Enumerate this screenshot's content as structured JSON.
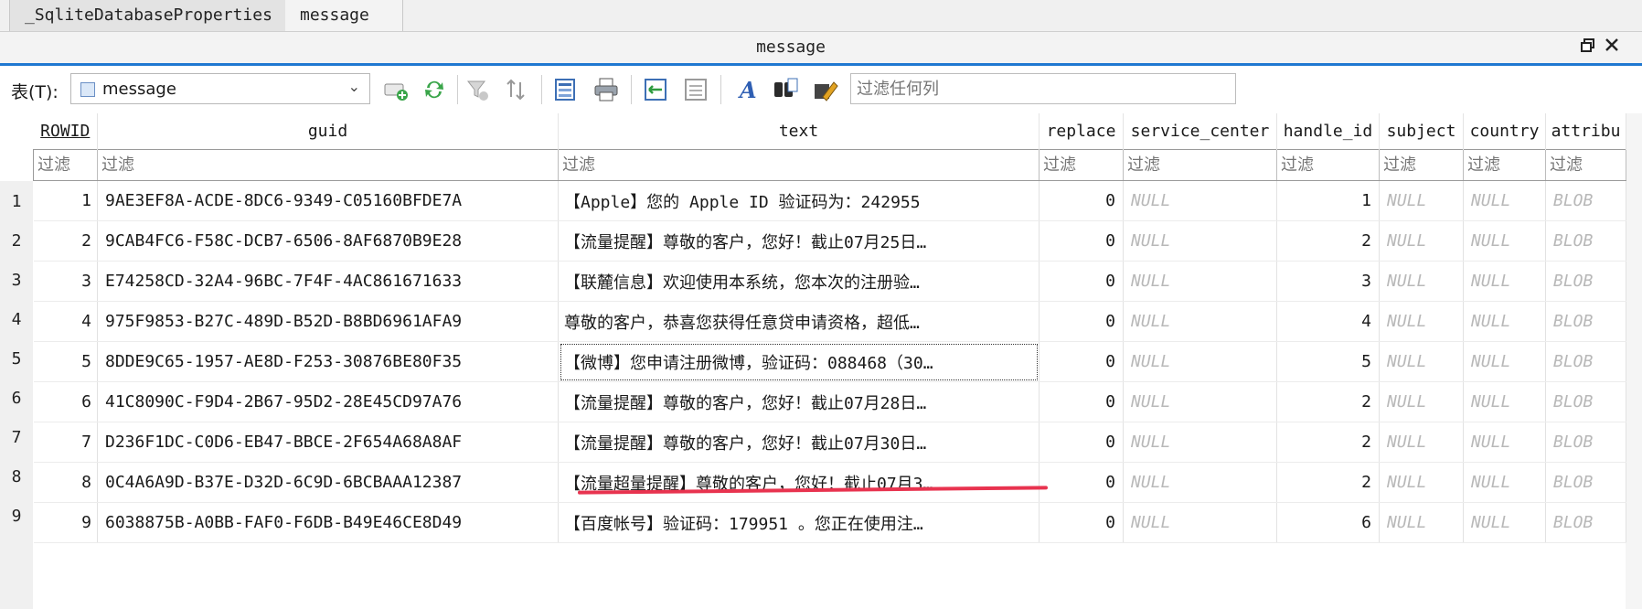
{
  "tabs": [
    {
      "label": "_SqliteDatabaseProperties",
      "active": true
    },
    {
      "label": "message",
      "active": false
    }
  ],
  "window": {
    "title": "message",
    "restore_icon": "restore-window-icon",
    "close_icon": "close-icon"
  },
  "toolbar": {
    "table_label": "表(T):",
    "table_select_value": "message",
    "filter_all_placeholder": "过滤任何列",
    "icons": [
      "add-record-icon",
      "refresh-icon",
      "clear-filter-icon",
      "sort-icon",
      "save-table-icon",
      "print-icon",
      "export-icon",
      "import-icon",
      "font-icon",
      "find-icon",
      "edit-icon"
    ]
  },
  "grid": {
    "columns": [
      {
        "key": "rowid",
        "label": "ROWID"
      },
      {
        "key": "guid",
        "label": "guid"
      },
      {
        "key": "text",
        "label": "text"
      },
      {
        "key": "replace",
        "label": "replace"
      },
      {
        "key": "service_center",
        "label": "service_center"
      },
      {
        "key": "handle_id",
        "label": "handle_id"
      },
      {
        "key": "subject",
        "label": "subject"
      },
      {
        "key": "country",
        "label": "country"
      },
      {
        "key": "attributed",
        "label": "attribu"
      }
    ],
    "filter_placeholder": "过滤",
    "null_text": "NULL",
    "blob_text": "BLOB",
    "rows": [
      {
        "num": "1",
        "rowid": "1",
        "guid": "9AE3EF8A-ACDE-8DC6-9349-C05160BFDE7A",
        "text": "【Apple】您的 Apple ID 验证码为：242955",
        "replace": "0",
        "handle_id": "1"
      },
      {
        "num": "2",
        "rowid": "2",
        "guid": "9CAB4FC6-F58C-DCB7-6506-8AF6870B9E28",
        "text": "【流量提醒】尊敬的客户，您好！截止07月25日…",
        "replace": "0",
        "handle_id": "2"
      },
      {
        "num": "3",
        "rowid": "3",
        "guid": "E74258CD-32A4-96BC-7F4F-4AC861671633",
        "text": "【联麓信息】欢迎使用本系统，您本次的注册验…",
        "replace": "0",
        "handle_id": "3"
      },
      {
        "num": "4",
        "rowid": "4",
        "guid": "975F9853-B27C-489D-B52D-B8BD6961AFA9",
        "text": "尊敬的客户，恭喜您获得任意贷申请资格，超低…",
        "replace": "0",
        "handle_id": "4"
      },
      {
        "num": "5",
        "rowid": "5",
        "guid": "8DDE9C65-1957-AE8D-F253-30876BE80F35",
        "text": "【微博】您申请注册微博，验证码：088468（30…",
        "replace": "0",
        "handle_id": "5"
      },
      {
        "num": "6",
        "rowid": "6",
        "guid": "41C8090C-F9D4-2B67-95D2-28E45CD97A76",
        "text": "【流量提醒】尊敬的客户，您好！截止07月28日…",
        "replace": "0",
        "handle_id": "2"
      },
      {
        "num": "7",
        "rowid": "7",
        "guid": "D236F1DC-C0D6-EB47-BBCE-2F654A68A8AF",
        "text": "【流量提醒】尊敬的客户，您好！截止07月30日…",
        "replace": "0",
        "handle_id": "2"
      },
      {
        "num": "8",
        "rowid": "8",
        "guid": "0C4A6A9D-B37E-D32D-6C9D-6BCBAAA12387",
        "text": "【流量超量提醒】尊敬的客户，您好！截止07月3…",
        "replace": "0",
        "handle_id": "2"
      },
      {
        "num": "9",
        "rowid": "9",
        "guid": "6038875B-A0BB-FAF0-F6DB-B49E46CE8D49",
        "text": "【百度帐号】验证码：179951 。您正在使用注…",
        "replace": "0",
        "handle_id": "6"
      }
    ]
  },
  "colors": {
    "accent": "#1f78d1",
    "annotation": "#e8334f",
    "null_text": "#b8b8b8"
  }
}
